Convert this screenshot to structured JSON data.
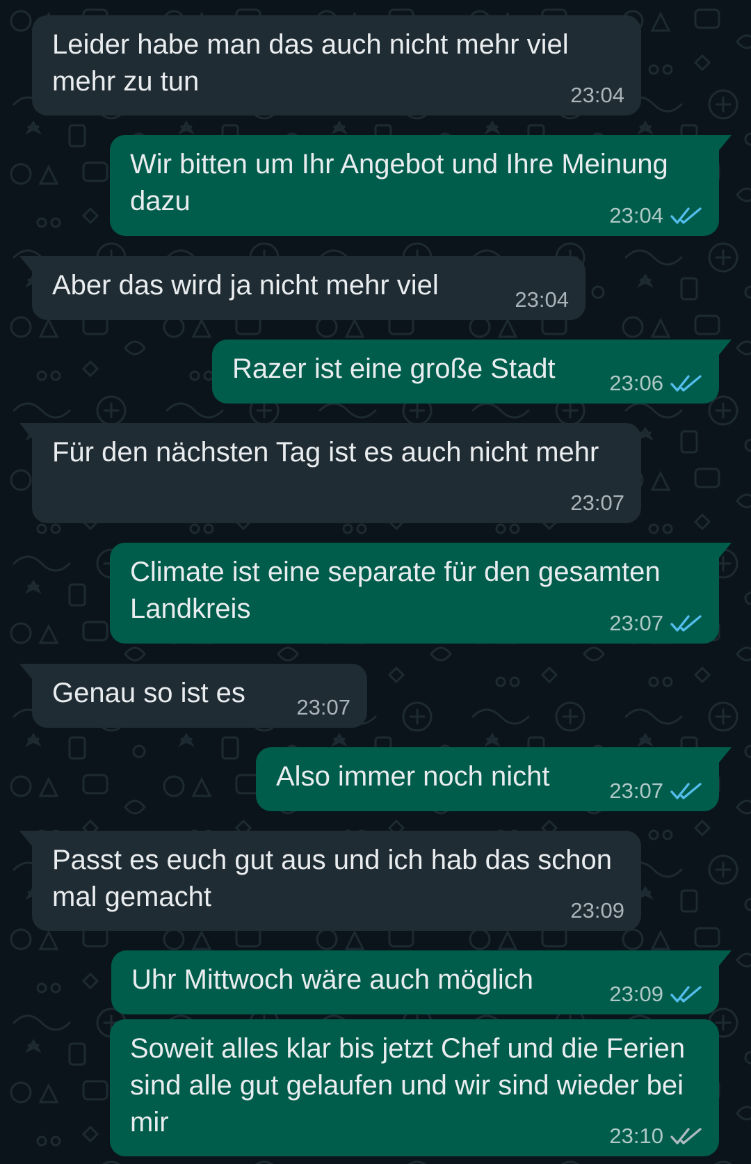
{
  "colors": {
    "background": "#0b141a",
    "incoming_bubble": "#202c33",
    "outgoing_bubble": "#005c4b",
    "text": "#e9edef",
    "read_ticks": "#53bdeb",
    "delivered_ticks": "#aebac1"
  },
  "messages": [
    {
      "direction": "incoming",
      "text": "Leider habe man das auch nicht mehr viel mehr zu tun",
      "time": "23:04"
    },
    {
      "direction": "outgoing",
      "text": "Wir bitten um Ihr Angebot und Ihre Meinung dazu",
      "time": "23:04",
      "status_icon": "double-check-read-icon"
    },
    {
      "direction": "incoming",
      "text": "Aber das wird ja nicht mehr viel",
      "time": "23:04"
    },
    {
      "direction": "outgoing",
      "text": "Razer ist eine große Stadt",
      "time": "23:06",
      "status_icon": "double-check-read-icon"
    },
    {
      "direction": "incoming",
      "text": "Für den nächsten Tag ist es auch nicht mehr",
      "time": "23:07"
    },
    {
      "direction": "outgoing",
      "text": "Climate ist eine separate für den gesamten Landkreis",
      "time": "23:07",
      "status_icon": "double-check-read-icon"
    },
    {
      "direction": "incoming",
      "text": "Genau so ist es",
      "time": "23:07"
    },
    {
      "direction": "outgoing",
      "text": "Also immer noch nicht",
      "time": "23:07",
      "status_icon": "double-check-read-icon"
    },
    {
      "direction": "incoming",
      "text": "Passt es euch gut aus und ich hab das schon mal gemacht",
      "time": "23:09"
    },
    {
      "direction": "outgoing",
      "text": "Uhr Mittwoch wäre auch möglich",
      "time": "23:09",
      "status_icon": "double-check-read-icon"
    },
    {
      "direction": "outgoing",
      "text": "Soweit alles klar bis jetzt Chef und die Ferien sind alle gut gelaufen und wir sind wieder bei mir",
      "time": "23:10",
      "status_icon": "double-check-delivered-icon"
    }
  ]
}
